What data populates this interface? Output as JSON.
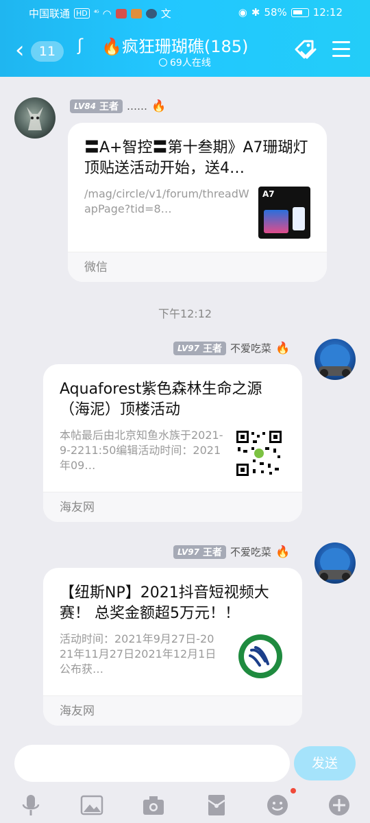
{
  "status_bar": {
    "carrier": "中国联通",
    "net": "HD",
    "signal": "⁴ᴳ",
    "battery": "58%",
    "time": "12:12"
  },
  "header": {
    "back_count": "11",
    "title": "疯狂珊瑚礁(185)",
    "online": "69人在线"
  },
  "messages": [
    {
      "level": "LV84",
      "rank": "王者",
      "nickname": "……",
      "card": {
        "title": "〓A+智控〓第十叁期》A7珊瑚灯顶贴送活动开始，送4…",
        "desc": "/mag/circle/v1/forum/threadWapPage?tid=8…",
        "thumb_label": "A7",
        "source": "微信"
      }
    },
    {
      "level": "LV97",
      "rank": "王者",
      "nickname": "不爱吃菜",
      "card": {
        "title": "Aquaforest紫色森林生命之源（海泥）顶楼活动",
        "desc": "本帖最后由北京知鱼水族于2021-9-2211:50编辑活动时间：2021年09…",
        "source": "海友网"
      }
    },
    {
      "level": "LV97",
      "rank": "王者",
      "nickname": "不爱吃菜",
      "card": {
        "title": "【纽斯NP】2021抖音短视频大赛！ 总奖金额超5万元！！",
        "desc": "活动时间：2021年9月27日-2021年11月27日2021年12月1日公布获…",
        "source": "海友网"
      }
    }
  ],
  "timestamp": "下午12:12",
  "input": {
    "send_label": "发送"
  },
  "colors": {
    "header_gradient": "#1fb6f0",
    "send_button": "#a5e3fb",
    "fire": "#f25c1d",
    "chat_bg": "#ececf1"
  }
}
